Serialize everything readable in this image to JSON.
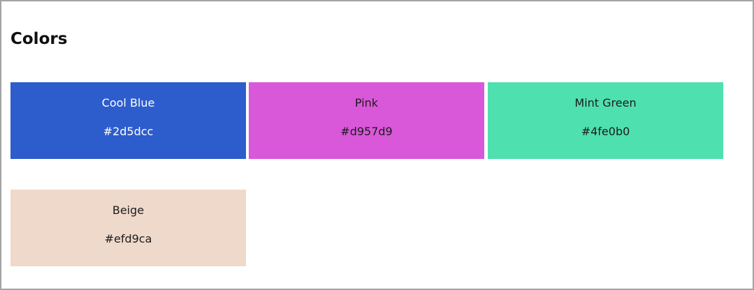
{
  "page": {
    "title": "Colors"
  },
  "swatches": [
    {
      "name": "Cool Blue",
      "hex": "#2d5dcc",
      "text_color": "#ffffff"
    },
    {
      "name": "Pink",
      "hex": "#d957d9",
      "text_color": "#1c1c1c"
    },
    {
      "name": "Mint Green",
      "hex": "#4fe0b0",
      "text_color": "#1c1c1c"
    },
    {
      "name": "Beige",
      "hex": "#efd9ca",
      "text_color": "#1c1c1c"
    }
  ]
}
